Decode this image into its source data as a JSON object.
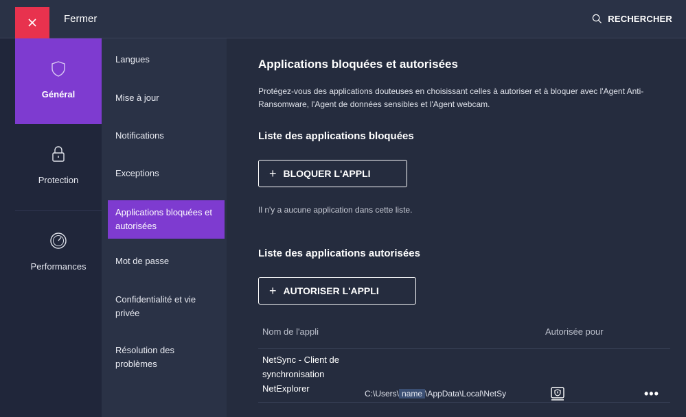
{
  "topbar": {
    "close_label": "Fermer",
    "search_label": "RECHERCHER"
  },
  "categories": [
    {
      "label": "Général",
      "icon": "shield-icon",
      "active": true
    },
    {
      "label": "Protection",
      "icon": "lock-icon",
      "active": false
    },
    {
      "label": "Performances",
      "icon": "speedometer-icon",
      "active": false
    }
  ],
  "subnav": {
    "items": [
      {
        "label": "Langues"
      },
      {
        "label": "Mise à jour"
      },
      {
        "label": "Notifications"
      },
      {
        "label": "Exceptions"
      },
      {
        "label": "Applications bloquées et autorisées",
        "active": true
      },
      {
        "label": "Mot de passe"
      },
      {
        "label": "Confidentialité et vie privée"
      },
      {
        "label": "Résolution des problèmes"
      }
    ]
  },
  "main": {
    "title": "Applications bloquées et autorisées",
    "description": "Protégez-vous des applications douteuses en choisissant celles à autoriser et à bloquer avec l'Agent Anti-Ransomware, l'Agent de données sensibles et l'Agent webcam.",
    "blocked": {
      "heading": "Liste des applications bloquées",
      "button": "BLOQUER L'APPLI",
      "empty": "Il n'y a aucune application dans cette liste."
    },
    "allowed": {
      "heading": "Liste des applications autorisées",
      "button": "AUTORISER L'APPLI",
      "col_name": "Nom de l'appli",
      "col_allowed_for": "Autorisée pour",
      "rows": [
        {
          "name": "NetSync - Client de synchronisation NetExplorer",
          "path_prefix": "C:\\Users\\",
          "path_masked": "name",
          "path_suffix": "\\AppData\\Local\\NetSy",
          "allowed_for_icon": "ransomware-shield-icon",
          "more": "•••"
        }
      ]
    }
  },
  "colors": {
    "background": "#252c3e",
    "panel": "#2a3246",
    "nav": "#20263a",
    "accent": "#7e3bd0",
    "close": "#e8324e"
  }
}
